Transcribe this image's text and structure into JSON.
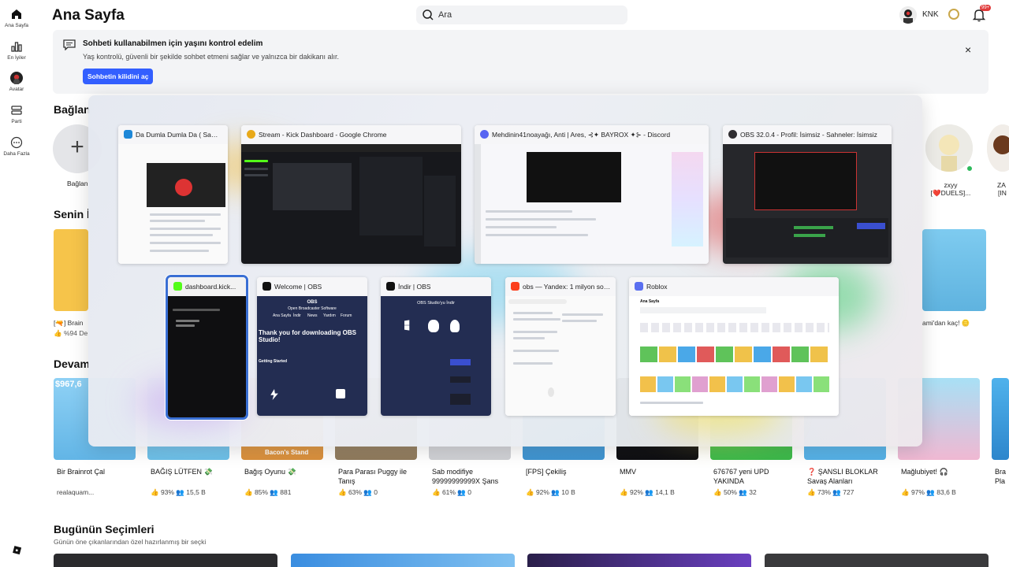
{
  "nav": {
    "items": [
      {
        "label": "Ana Sayfa",
        "icon": "home-icon"
      },
      {
        "label": "En İyiler",
        "icon": "charts-icon"
      },
      {
        "label": "Avatar",
        "icon": "avatar-icon"
      },
      {
        "label": "Parti",
        "icon": "party-icon"
      },
      {
        "label": "Daha Fazla",
        "icon": "more-icon"
      }
    ]
  },
  "header": {
    "title": "Ana Sayfa",
    "search_placeholder": "Ara",
    "username": "KNK",
    "notifications_badge": "99+"
  },
  "banner": {
    "title": "Sohbeti kullanabilmen için yaşını kontrol edelim",
    "description": "Yaş kontrolü, güvenli bir şekilde sohbet etmeni sağlar ve yalnızca bir dakikanı alır.",
    "button": "Sohbetin kilidini aç",
    "close": "×"
  },
  "sections": {
    "connections": "Bağlan",
    "add_friend_label": "Bağlan",
    "recommended": "Senin İ",
    "continue": "Devam",
    "todays_picks": "Bugünün Seçimleri",
    "todays_picks_sub": "Günün öne çıkanlarından özel hazırlanmış bir seçki"
  },
  "friends": [
    {
      "name": "zxyy",
      "subtitle": "[❤️DUELS]..."
    },
    {
      "name": "ZA",
      "subtitle": "[IN"
    }
  ],
  "recommended_partial": {
    "left_title": "[🔫] Brain",
    "left_stats": "👍 %94 De",
    "right_title": "ami'dan kaç! 🪙"
  },
  "games": [
    {
      "name": "Bir Brainrot Çal",
      "stats": "realaquam...",
      "thumb_label": "$967,6"
    },
    {
      "name": "BAĞIŞ LÜTFEN 💸",
      "stats": "👍 93%   👥 15,5 B"
    },
    {
      "name": "Bağış Oyunu 💸",
      "stats": "👍 85%   👥 881",
      "thumb_label": "Bacon's Stand"
    },
    {
      "name": "Para Parası Puggy ile Tanış",
      "stats": "👍 63%   👥 0"
    },
    {
      "name": "Sab modifiye 99999999999X Şans",
      "stats": "👍 61%   👥 0"
    },
    {
      "name": "[FPS] Çekiliş",
      "stats": "👍 92%   👥 10 B"
    },
    {
      "name": "MMV",
      "stats": "👍 92%   👥 14,1 B"
    },
    {
      "name": "676767 yeni UPD YAKINDA",
      "stats": "👍 50%   👥 32"
    },
    {
      "name": "❓ ŞANSLI BLOKLAR Savaş Alanları",
      "stats": "👍 73%   👥 727"
    },
    {
      "name": "Mağlubiyet! 🎧",
      "stats": "👍 97%   👥 83,6 B"
    },
    {
      "name": "Bra Pla",
      "stats": ""
    }
  ],
  "switcher": {
    "row1": [
      {
        "title": "Da Dumla Dumla Da ( Same...",
        "icon": "edge-icon",
        "color": "#1e88d8"
      },
      {
        "title": "Stream - Kick Dashboard - Google Chrome",
        "icon": "chrome-icon",
        "color": "#e8a91a"
      },
      {
        "title": "Mehdinin41noayağı, Anti | Ares, ⊰✦ BAYROX ✦⊱ - Discord",
        "icon": "discord-icon",
        "color": "#5865f2"
      },
      {
        "title": "OBS 32.0.4 - Profil: İsimsiz - Sahneler: İsimsiz",
        "icon": "obs-icon",
        "color": "#302e31"
      }
    ],
    "row2": [
      {
        "title": "dashboard.kick...",
        "icon": "kick-icon",
        "color": "#53fc18"
      },
      {
        "title": "Welcome | OBS",
        "icon": "obs-icon",
        "color": "#111111"
      },
      {
        "title": "İndir | OBS",
        "icon": "obs-icon",
        "color": "#111111"
      },
      {
        "title": "obs — Yandex: 1 milyon son...",
        "icon": "yandex-icon",
        "color": "#fc3f1d"
      },
      {
        "title": "Roblox",
        "icon": "roblox-icon",
        "color": "#5a6ff0"
      }
    ],
    "obs_welcome": {
      "brand": "OBS",
      "brand_sub": "Open Broadcaster Software",
      "nav": [
        "Ana Sayfa",
        "İndir",
        "News",
        "Yardım",
        "Forum"
      ],
      "heading": "Thank you for downloading OBS Studio!",
      "getting_started": "Getting Started"
    },
    "obs_download": {
      "heading": "OBS Studio'yu İndir",
      "buttons": [
        "Windows",
        "macOS",
        "Linux"
      ]
    },
    "roblox_preview": {
      "title": "Ana Sayfa"
    }
  },
  "colors": {
    "accent": "#335fff",
    "selected_outline": "#3a6fd4"
  }
}
